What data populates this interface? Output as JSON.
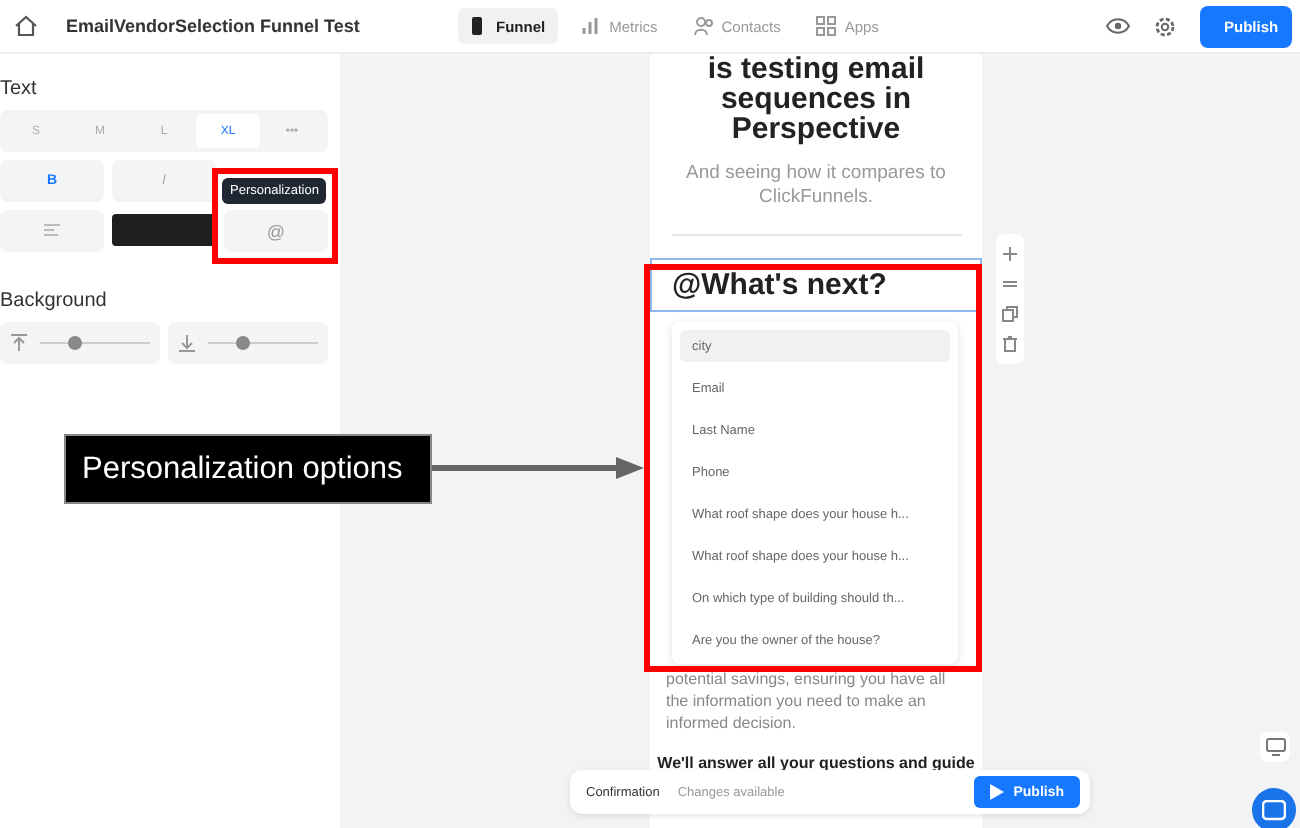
{
  "topbar": {
    "title": "EmailVendorSelection Funnel Test",
    "tabs": [
      {
        "label": "Funnel",
        "selected": true
      },
      {
        "label": "Metrics",
        "selected": false
      },
      {
        "label": "Contacts",
        "selected": false
      },
      {
        "label": "Apps",
        "selected": false
      }
    ],
    "publish": "Publish"
  },
  "sidebar": {
    "text_heading": "Text",
    "sizes": [
      {
        "label": "S",
        "selected": false
      },
      {
        "label": "M",
        "selected": false
      },
      {
        "label": "L",
        "selected": false
      },
      {
        "label": "XL",
        "selected": true
      },
      {
        "label": "•••",
        "selected": false
      }
    ],
    "bold": {
      "label": "B",
      "on": true
    },
    "italic": {
      "label": "I",
      "on": false
    },
    "tooltip": "Personalization",
    "personalize_icon": "@",
    "background_heading": "Background",
    "sliders": [
      {
        "level": 0.3
      },
      {
        "level": 0.3
      }
    ]
  },
  "page": {
    "heading": [
      "is testing email",
      "sequences in",
      "Perspective"
    ],
    "subtitle": "And seeing how it compares to ClickFunnels.",
    "field_value": "@What's next?",
    "dropdown": [
      {
        "label": "city",
        "selected": true
      },
      {
        "label": "Email",
        "selected": false
      },
      {
        "label": "Last Name",
        "selected": false
      },
      {
        "label": "Phone",
        "selected": false
      },
      {
        "label": "What roof shape does your house h...",
        "selected": false
      },
      {
        "label": "What roof shape does your house h...",
        "selected": false
      },
      {
        "label": "On which type of building should th...",
        "selected": false
      },
      {
        "label": "Are you the owner of the house?",
        "selected": false
      }
    ],
    "paragraph": "potential savings, ensuring you have all the information you need to make an informed decision.",
    "bold_line": "We'll answer all your questions and guide"
  },
  "callout": "Personalization options",
  "bottom_bar": {
    "page": "Confirmation",
    "status": "Changes available",
    "publish": "Publish"
  }
}
